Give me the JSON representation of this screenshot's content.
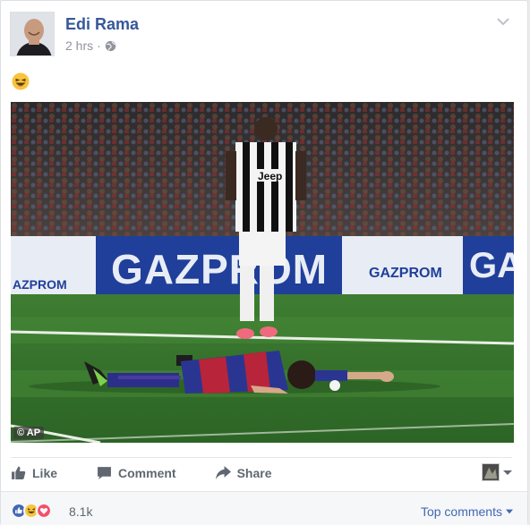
{
  "post": {
    "author": "Edi Rama",
    "time": "2 hrs",
    "separator": "·",
    "text_emoji": "laughing-face",
    "photo": {
      "banner_text": "GAZPROM",
      "banner_left_text": "AZPROM",
      "banner_right_text": "GA",
      "banner_logo_text": "GAZPROM",
      "shirt_sponsor": "Jeep",
      "credit": "© AP"
    }
  },
  "actions": {
    "like": "Like",
    "comment": "Comment",
    "share": "Share"
  },
  "reactions": {
    "types": [
      "like",
      "haha",
      "love"
    ],
    "count": "8.1k"
  },
  "comments_filter": {
    "label": "Top comments"
  },
  "colors": {
    "link": "#365899",
    "action_text": "#606770",
    "like_blue": "#4267b2",
    "haha_yellow": "#f7c53a",
    "love_red": "#f25268"
  }
}
